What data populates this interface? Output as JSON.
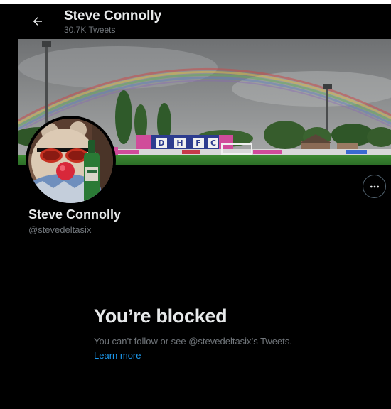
{
  "header": {
    "name": "Steve Connolly",
    "tweet_count": "30.7K Tweets"
  },
  "banner": {
    "stand_letters": [
      "D",
      "H",
      "F",
      "C"
    ]
  },
  "profile": {
    "name": "Steve Connolly",
    "handle": "@stevedeltasix"
  },
  "blocked": {
    "title": "You’re blocked",
    "description": "You can’t follow or see @stevedeltasix’s Tweets.",
    "link": "Learn more"
  },
  "colors": {
    "background": "#000000",
    "text_primary": "#e7e9ea",
    "text_secondary": "#71767b",
    "link": "#1d9bf0",
    "border": "#536471"
  },
  "icons": {
    "back": "arrow-left-icon",
    "more": "ellipsis-icon"
  }
}
